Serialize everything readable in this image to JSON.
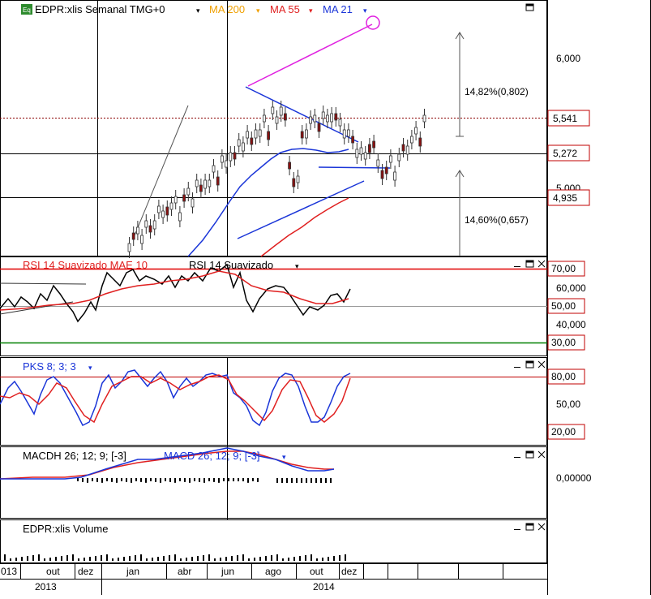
{
  "main_panel": {
    "symbol_badge": "Eq",
    "title": "EDPR:xlis Semanal TMG+0",
    "indicators": [
      {
        "label": "MA 200",
        "color": "#f0a000"
      },
      {
        "label": "MA 55",
        "color": "#e02020"
      },
      {
        "label": "MA 21",
        "color": "#1a35d8"
      }
    ],
    "axis_ticks": [
      "6,000",
      "5,000"
    ],
    "price_labels": [
      {
        "text": "5,541",
        "color": "#c00000"
      },
      {
        "text": "5,272",
        "color": "#c00000"
      },
      {
        "text": "4,935",
        "color": "#c00000"
      }
    ],
    "annotations": [
      "14,82%(0,802)",
      "14,60%(0,657)"
    ]
  },
  "rsi_panel": {
    "title1": "RSI 14 Suavizado MAE 10",
    "title2": "RSI 14 Suavizado",
    "levels": [
      {
        "text": "70,00",
        "color": "#c00000"
      },
      {
        "text": "50,00",
        "color": "#c00000"
      },
      {
        "text": "30,00",
        "color": "#c00000"
      }
    ],
    "axis_ticks": [
      "60,000",
      "40,000"
    ]
  },
  "pks_panel": {
    "title": "PKS 8; 3; 3",
    "levels": [
      {
        "text": "80,00",
        "color": "#c00000"
      },
      {
        "text": "20,00",
        "color": "#c00000"
      }
    ],
    "axis_ticks": [
      "50,00"
    ]
  },
  "macd_panel": {
    "title1": "MACDH 26; 12; 9; [-3]",
    "title2": "MACD 26; 12; 9; [-3]",
    "axis_ticks": [
      "0,00000"
    ]
  },
  "volume_panel": {
    "title": "EDPR:xlis Volume"
  },
  "time_axis": {
    "months": [
      "013",
      "out",
      "dez",
      "jan",
      "abr",
      "jun",
      "ago",
      "out",
      "dez"
    ],
    "years": [
      "2013",
      "2014"
    ]
  }
}
